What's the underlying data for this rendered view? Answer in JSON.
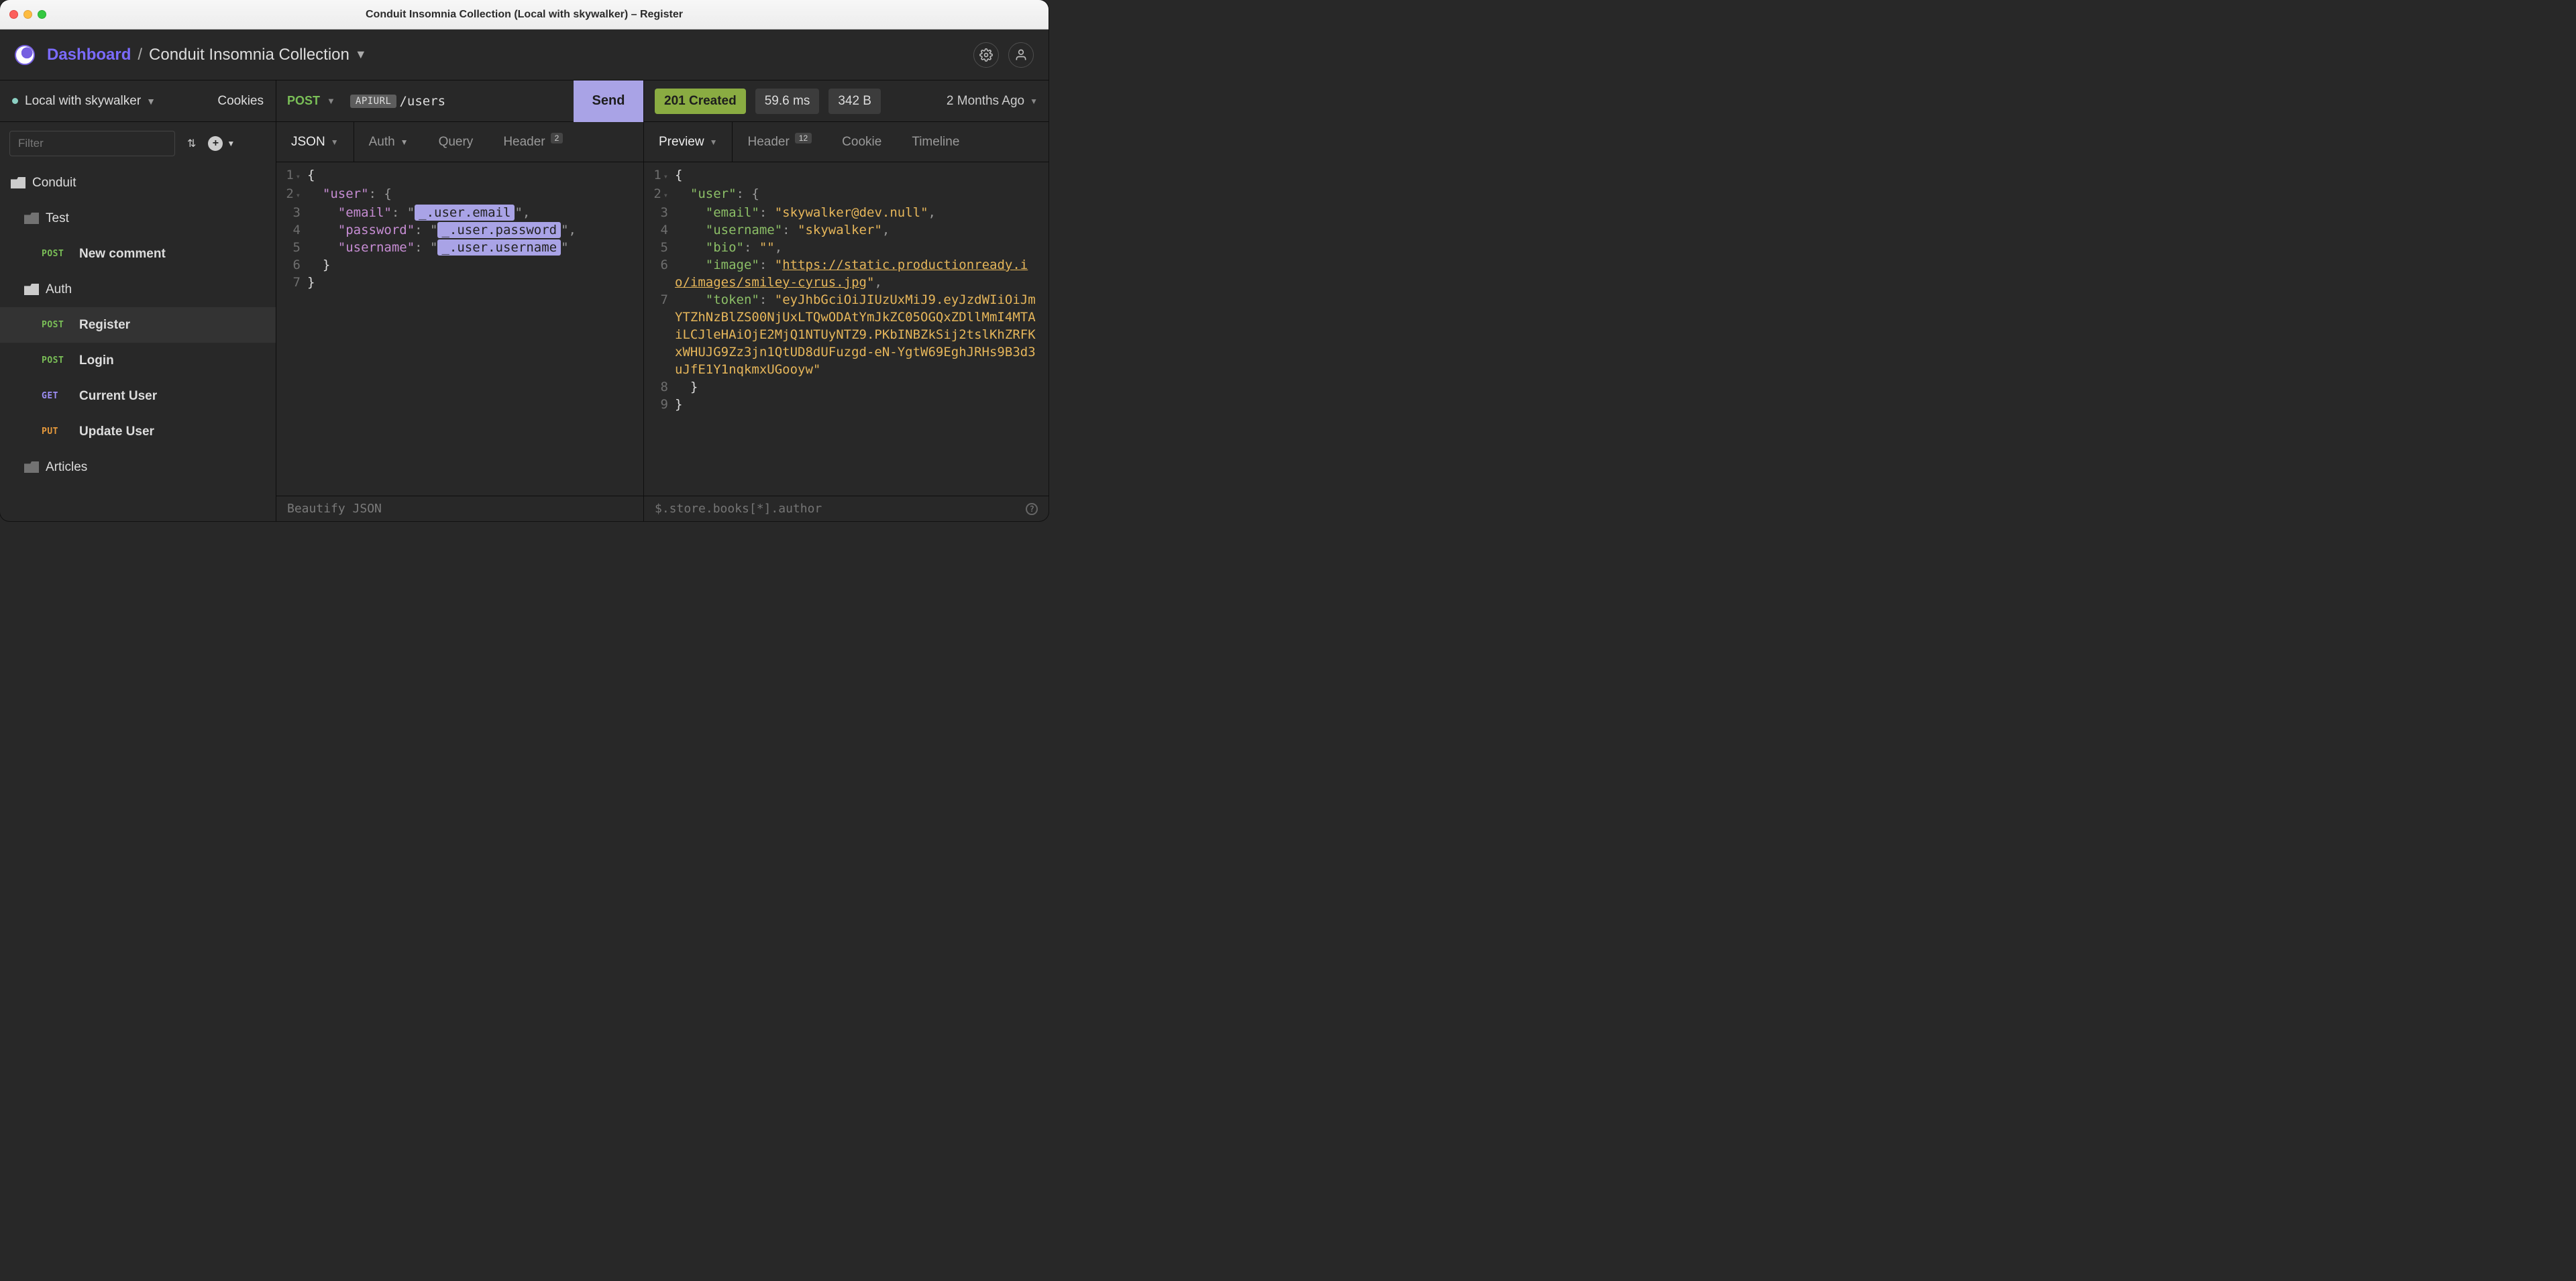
{
  "window": {
    "title": "Conduit Insomnia Collection (Local with skywalker) – Register"
  },
  "header": {
    "dashboard": "Dashboard",
    "sep": "/",
    "collection": "Conduit Insomnia Collection"
  },
  "sidebar": {
    "env_name": "Local with skywalker",
    "cookies": "Cookies",
    "filter_placeholder": "Filter"
  },
  "tree": {
    "root_folder": "Conduit",
    "test_folder": "Test",
    "test_items": [
      {
        "method": "POST",
        "label": "New comment"
      }
    ],
    "auth_folder": "Auth",
    "auth_items": [
      {
        "method": "POST",
        "label": "Register",
        "active": true
      },
      {
        "method": "POST",
        "label": "Login"
      },
      {
        "method": "GET",
        "label": "Current User"
      },
      {
        "method": "PUT",
        "label": "Update User"
      }
    ],
    "articles_folder": "Articles"
  },
  "request": {
    "method": "POST",
    "url_env": "APIURL",
    "url_path": "/users",
    "send": "Send",
    "tabs": {
      "body": "JSON",
      "auth": "Auth",
      "query": "Query",
      "header": "Header",
      "header_badge": "2"
    },
    "body_lines": {
      "l1": "{",
      "l2_key": "\"user\"",
      "l2_rest": ": {",
      "l3_key": "\"email\"",
      "l3_var": "_.user.email",
      "l4_key": "\"password\"",
      "l4_var": "_.user.password",
      "l5_key": "\"username\"",
      "l5_var": "_.user.username",
      "l6": "  }",
      "l7": "}"
    },
    "footer": "Beautify JSON"
  },
  "response": {
    "status": "201 Created",
    "time": "59.6 ms",
    "size": "342 B",
    "age": "2 Months Ago",
    "tabs": {
      "preview": "Preview",
      "header": "Header",
      "header_badge": "12",
      "cookie": "Cookie",
      "timeline": "Timeline"
    },
    "body_lines": {
      "l1": "{",
      "l2_key": "\"user\"",
      "l2_rest": ": {",
      "l3_key": "\"email\"",
      "l3_val": "\"skywalker@dev.null\"",
      "l4_key": "\"username\"",
      "l4_val": "\"skywalker\"",
      "l5_key": "\"bio\"",
      "l5_val": "\"\"",
      "l6_key": "\"image\"",
      "l6_url": "https://static.productionready.io/images/smiley-cyrus.jpg",
      "l7_key": "\"token\"",
      "l7_val": "\"eyJhbGciOiJIUzUxMiJ9.eyJzdWIiOiJmYTZhNzBlZS00NjUxLTQwODAtYmJkZC05OGQxZDllMmI4MTAiLCJleHAiOjE2MjQ1NTUyNTZ9.PKbINBZkSij2tslKhZRFKxWHUJG9Zz3jn1QtUD8dUFuzgd-eN-YgtW69EghJRHs9B3d3uJfE1Y1nqkmxUGooyw\"",
      "l8": "  }",
      "l9": "}"
    },
    "footer_placeholder": "$.store.books[*].author"
  }
}
